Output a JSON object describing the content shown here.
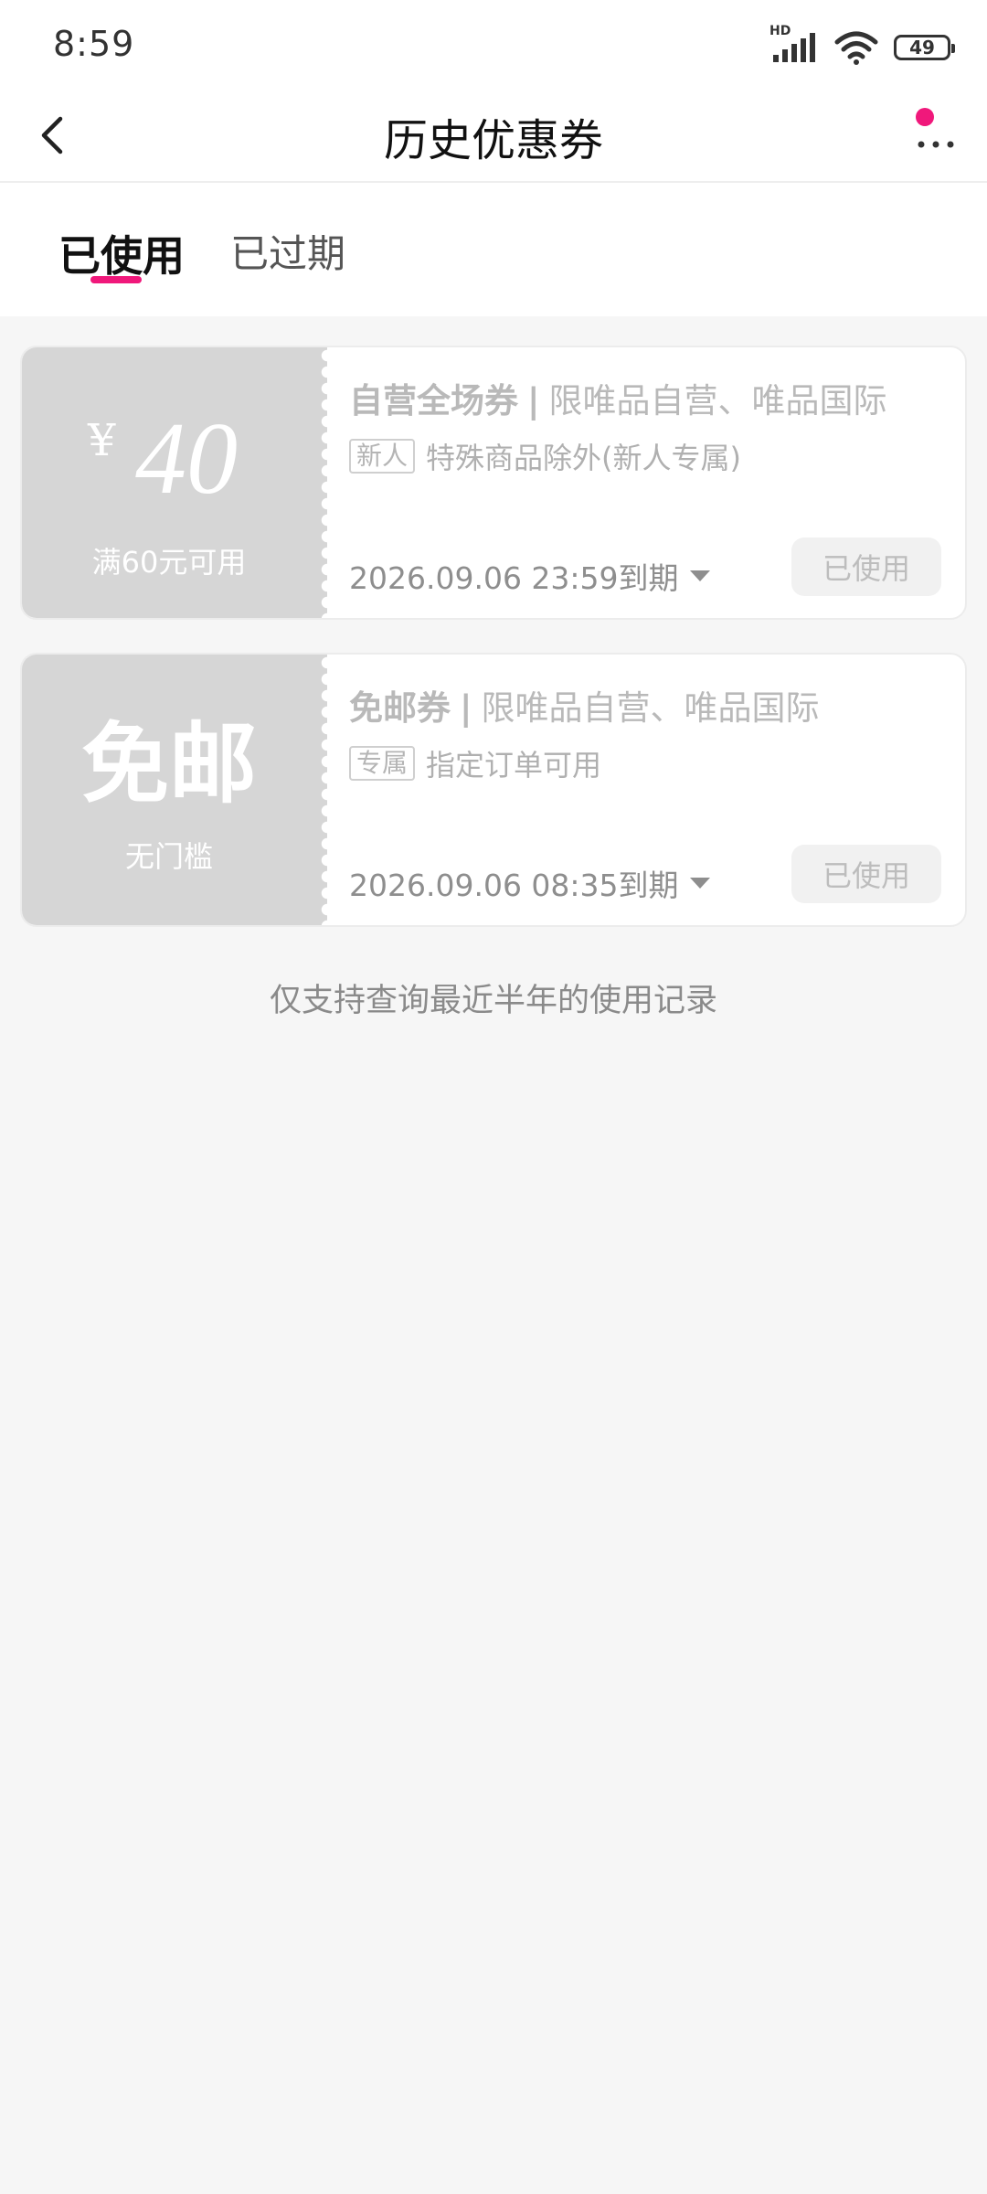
{
  "status": {
    "time": "8:59",
    "hd": "HD",
    "battery": "49"
  },
  "nav": {
    "title": "历史优惠券"
  },
  "tabs": [
    {
      "label": "已使用",
      "active": true
    },
    {
      "label": "已过期",
      "active": false
    }
  ],
  "coupons": [
    {
      "currency": "¥",
      "amount": "40",
      "condition": "满60元可用",
      "title": "自营全场券",
      "separator": "|",
      "scope": "限唯品自营、唯品国际",
      "tag": "新人",
      "desc": "特殊商品除外(新人专属)",
      "expiry": "2026.09.06 23:59到期",
      "status_label": "已使用"
    },
    {
      "big_label": "免邮",
      "condition": "无门槛",
      "title": "免邮券",
      "separator": "|",
      "scope": "限唯品自营、唯品国际",
      "tag": "专属",
      "desc": "指定订单可用",
      "expiry": "2026.09.06 08:35到期",
      "status_label": "已使用"
    }
  ],
  "footer": {
    "note": "仅支持查询最近半年的使用记录"
  },
  "colors": {
    "accent": "#f0187b",
    "coupon_left_bg": "#d6d6d6",
    "page_bg": "#f6f6f6"
  }
}
